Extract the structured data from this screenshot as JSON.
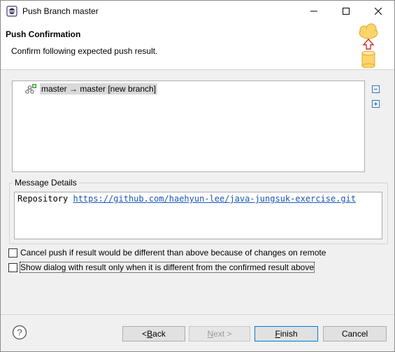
{
  "window": {
    "title": "Push Branch master",
    "icons": {
      "app": "eclipse-icon",
      "minimize": "minimize-icon",
      "maximize": "maximize-icon",
      "close": "close-icon"
    }
  },
  "header": {
    "title": "Push Confirmation",
    "description": "Confirm following expected push result.",
    "image_icon": "cloud-upload-database-icon"
  },
  "results": {
    "items": [
      {
        "label": "master → master [new branch]",
        "icon": "push-branch-icon"
      }
    ],
    "collapse_icon": "collapse-all-icon",
    "expand_icon": "expand-all-icon"
  },
  "message_details": {
    "title": "Message Details",
    "repo_label": "Repository",
    "repo_url": "https://github.com/haehyun-lee/java-jungsuk-exercise.git"
  },
  "options": [
    {
      "label": "Cancel push if result would be different than above because of changes on remote",
      "checked": false
    },
    {
      "label": "Show dialog with result only when it is different from the confirmed result above",
      "checked": false
    }
  ],
  "footer": {
    "help_icon": "help-icon",
    "back_prefix": "< ",
    "back_mnemonic": "B",
    "back_rest": "ack",
    "next_mnemonic": "N",
    "next_rest": "ext >",
    "finish_mnemonic": "F",
    "finish_rest": "inish",
    "cancel_label": "Cancel"
  }
}
